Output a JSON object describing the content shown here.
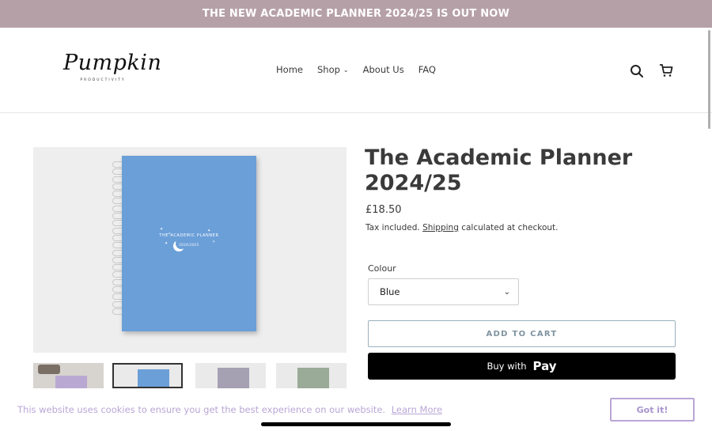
{
  "announcement": {
    "text": "THE NEW ACADEMIC PLANNER 2024/25 IS OUT NOW"
  },
  "header": {
    "logo_script": "Pumpkin",
    "logo_sub": "PRODUCTIVITY",
    "nav": [
      {
        "label": "Home"
      },
      {
        "label": "Shop"
      },
      {
        "label": "About Us"
      },
      {
        "label": "FAQ"
      }
    ],
    "icons": {
      "search": "search-icon",
      "cart": "cart-icon"
    }
  },
  "product": {
    "title": "The Academic Planner 2024/25",
    "price": "£18.50",
    "tax_prefix": "Tax included.",
    "tax_link": "Shipping",
    "tax_suffix": "calculated at checkout.",
    "colour_label": "Colour",
    "colour_selected": "Blue",
    "add_to_cart": "ADD TO CART",
    "buy_with": "Buy with",
    "pay_brand": "Pay",
    "image": {
      "cover_title": "THE ACADEMIC PLANNER",
      "cover_sub": "2024/2025",
      "cover_color": "#6b9fd8"
    },
    "thumbnails": [
      "lifestyle",
      "blue",
      "lilac",
      "sage"
    ]
  },
  "cookie": {
    "text": "This website uses cookies to ensure you get the best experience on our website.",
    "link": "Learn More",
    "button": "Got it!"
  },
  "colors": {
    "announcement_bg": "#b6a0a8",
    "cookie_accent": "#b9a6d6",
    "button_outline": "#9bb0bd"
  }
}
